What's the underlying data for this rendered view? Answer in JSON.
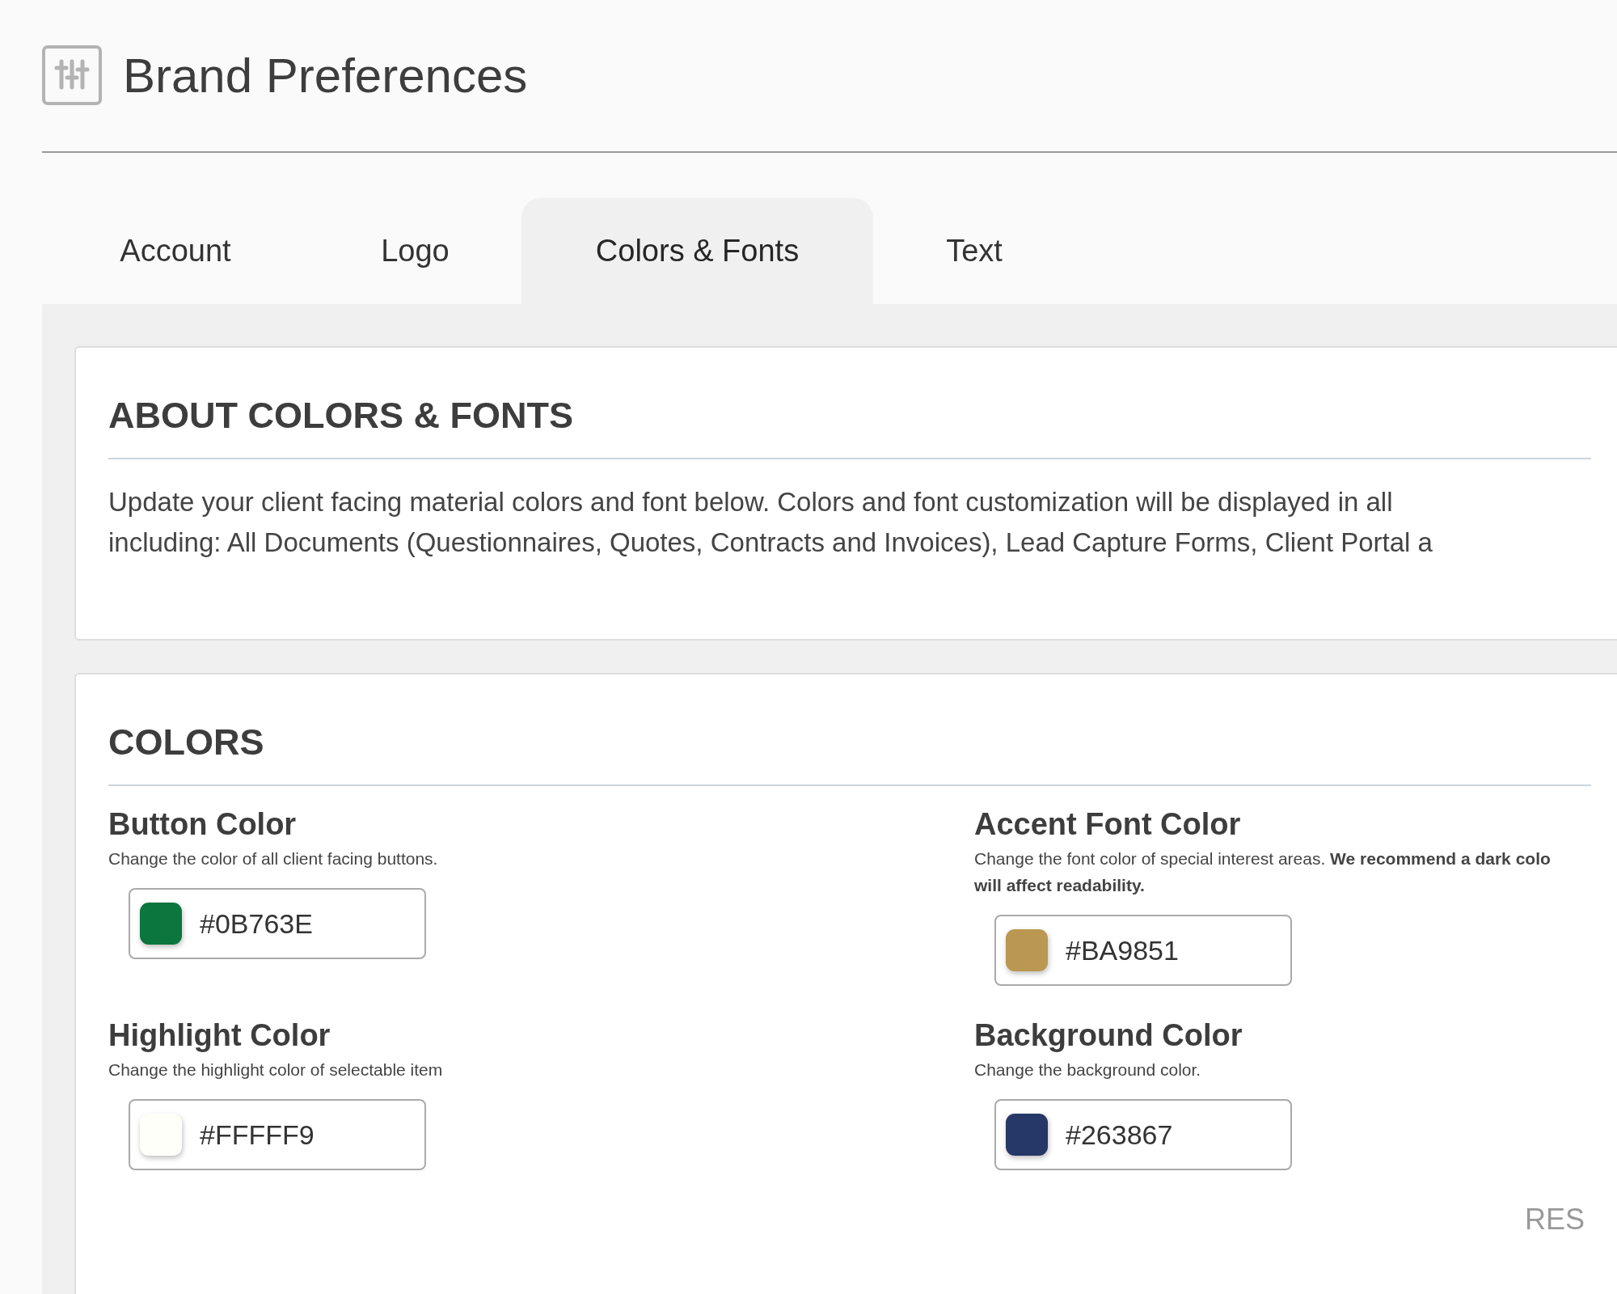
{
  "page": {
    "title": "Brand Preferences"
  },
  "tabs": [
    {
      "label": "Account",
      "selected": false
    },
    {
      "label": "Logo",
      "selected": false
    },
    {
      "label": "Colors & Fonts",
      "selected": true
    },
    {
      "label": "Text",
      "selected": false
    }
  ],
  "about": {
    "heading": "ABOUT COLORS & FONTS",
    "lines": [
      "Update your client facing material colors and font below. Colors and font customization will be displayed in all",
      "including: All Documents (Questionnaires, Quotes, Contracts and Invoices), Lead Capture Forms, Client Portal a"
    ]
  },
  "colors": {
    "heading": "COLORS",
    "fields": [
      {
        "label": "Button Color",
        "description": [
          "Change the color of all client facing buttons."
        ],
        "value": "#0B763E",
        "color": "#0b763e"
      },
      {
        "label": "Accent Font Color",
        "description": [
          "Change the font color of special interest areas. **We recommend a dark colo**",
          "**will affect readability.**"
        ],
        "value": "#BA9851",
        "color": "#ba9851"
      },
      {
        "label": "Highlight Color",
        "description": [
          "Change the highlight color of selectable item"
        ],
        "value": "#FFFFF9",
        "color": "#fffff9"
      },
      {
        "label": "Background Color",
        "description": [
          "Change the background color."
        ],
        "value": "#263867",
        "color": "#263867"
      }
    ],
    "reset_button": "RES"
  }
}
